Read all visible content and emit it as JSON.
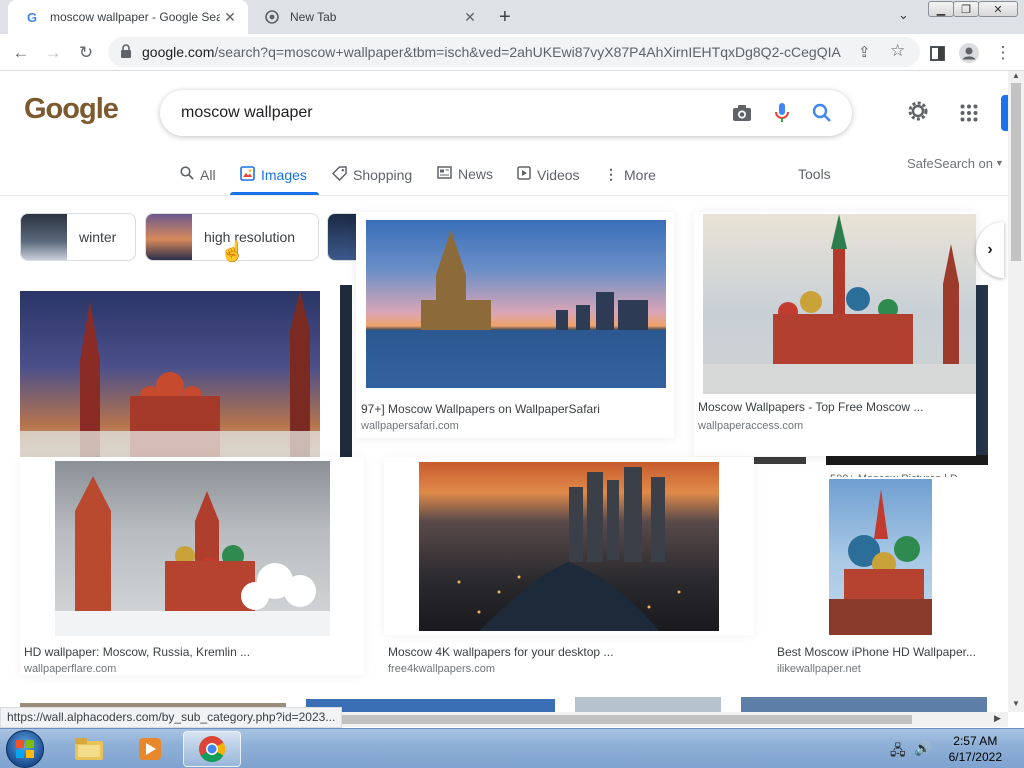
{
  "browser": {
    "tabs": [
      {
        "title": "moscow wallpaper - Google Sear",
        "favicon": "google-g-icon",
        "active": true
      },
      {
        "title": "New Tab",
        "favicon": "chrome-icon",
        "active": false
      }
    ],
    "new_tab_symbol": "+",
    "url_host": "google.com",
    "url_rest": "/search?q=moscow+wallpaper&tbm=isch&ved=2ahUKEwi87vyX87P4AhXirnIEHTqxDg8Q2-cCegQIA..."
  },
  "search": {
    "logo_text": "Google",
    "query": "moscow wallpaper",
    "safesearch": "SafeSearch on",
    "tools_label": "Tools",
    "tabs": [
      {
        "label": "All",
        "icon": "search-icon"
      },
      {
        "label": "Images",
        "icon": "image-icon"
      },
      {
        "label": "Shopping",
        "icon": "tag-icon"
      },
      {
        "label": "News",
        "icon": "news-icon"
      },
      {
        "label": "Videos",
        "icon": "play-icon"
      },
      {
        "label": "More",
        "icon": "more-vert-icon"
      }
    ],
    "chips": [
      {
        "label": "winter"
      },
      {
        "label": "high resolution"
      }
    ]
  },
  "results": [
    {
      "caption": "97+] Moscow Wallpapers on WallpaperSafari",
      "source": "wallpapersafari.com"
    },
    {
      "caption": "Moscow Wallpapers - Top Free Moscow ...",
      "source": "wallpaperaccess.com"
    },
    {
      "caption": "HD wallpaper: Moscow, Russia, Kremlin ...",
      "source": "wallpaperflare.com"
    },
    {
      "caption": "Moscow 4K wallpapers for your desktop ...",
      "source": "free4kwallpapers.com"
    },
    {
      "caption": "Best Moscow iPhone HD Wallpaper...",
      "source": "ilikewallpaper.net"
    }
  ],
  "partial_captions": {
    "behind_right": "500+ Moscow Pictures | D",
    "behind_mid": "xe"
  },
  "status_url": "https://wall.alphacoders.com/by_sub_category.php?id=2023...",
  "taskbar": {
    "time": "2:57 AM",
    "date": "6/17/2022"
  },
  "colors": {
    "accent": "#1a73e8",
    "taskbar": "#8fb0d7"
  }
}
